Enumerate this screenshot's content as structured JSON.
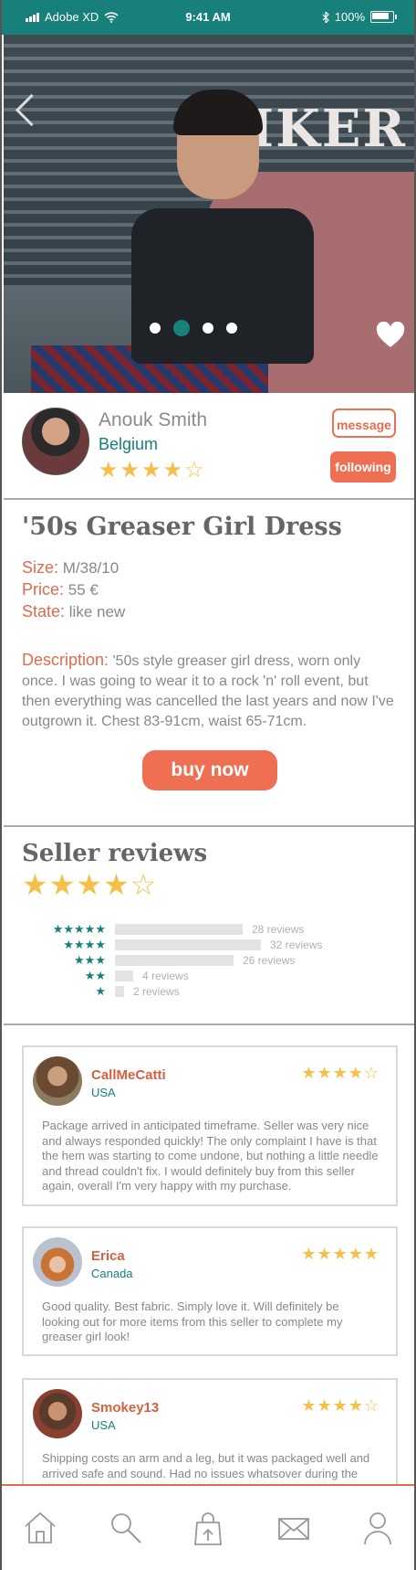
{
  "status_bar": {
    "carrier": "Adobe XD",
    "time": "9:41 AM",
    "battery": "100%"
  },
  "hero": {
    "active_image_index": 1,
    "image_count": 4
  },
  "seller": {
    "name": "Anouk Smith",
    "country": "Belgium",
    "stars": "★★★★☆",
    "message_label": "message",
    "following_label": "following"
  },
  "product": {
    "title": "'50s Greaser Girl Dress",
    "size_label": "Size:",
    "size_value": "M/38/10",
    "price_label": "Price:",
    "price_value": "55 €",
    "state_label": "State:",
    "state_value": "like new",
    "description_label": "Description:",
    "description_text": "'50s style greaser girl dress, worn only once. I was going to wear it to a rock 'n' roll event, but then everything was cancelled the last years and now I've outgrown it. Chest 83-91cm, waist 65-71cm.",
    "buy_label": "buy now"
  },
  "reviews_summary": {
    "title": "Seller reviews",
    "stars": "★★★★☆",
    "rows": [
      {
        "stars": "★★★★★",
        "count": 28,
        "label": "28 reviews"
      },
      {
        "stars": "★★★★",
        "count": 32,
        "label": "32 reviews"
      },
      {
        "stars": "★★★",
        "count": 26,
        "label": "26 reviews"
      },
      {
        "stars": "★★",
        "count": 4,
        "label": "4 reviews"
      },
      {
        "stars": "★",
        "count": 2,
        "label": "2 reviews"
      }
    ]
  },
  "reviews": [
    {
      "name": "CallMeCatti",
      "country": "USA",
      "stars": "★★★★☆",
      "text": "Package arrived in anticipated timeframe. Seller was very nice and always responded quickly! The only complaint I have is that the hem was starting to come undone, but nothing a little needle and thread couldn't fix. I would definitely buy from this seller again, overall I'm very happy with my purchase."
    },
    {
      "name": "Erica",
      "country": "Canada",
      "stars": "★★★★★",
      "text": "Good quality. Best fabric. Simply love it. Will definitely be looking out for more items from this seller to complete my greaser girl look!"
    },
    {
      "name": "Smokey13",
      "country": "USA",
      "stars": "★★★★☆",
      "text": "Shipping costs an arm and a leg, but it was packaged well and arrived safe and sound. Had no issues whatsover during the"
    }
  ],
  "colors": {
    "teal": "#17807a",
    "coral": "#ee6f52",
    "star": "#f5c04a"
  },
  "nav_icons": [
    "home-icon",
    "search-icon",
    "sell-icon",
    "mail-icon",
    "profile-icon"
  ]
}
